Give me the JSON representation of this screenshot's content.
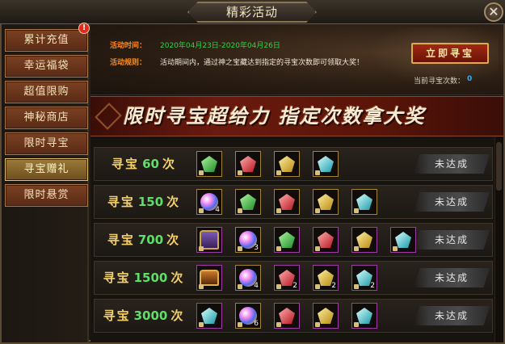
{
  "window": {
    "title": "精彩活动",
    "close_label": "✕"
  },
  "sidebar": {
    "badge": "!",
    "items": [
      {
        "label": "累计充值"
      },
      {
        "label": "幸运福袋"
      },
      {
        "label": "超值限购"
      },
      {
        "label": "神秘商店"
      },
      {
        "label": "限时寻宝"
      },
      {
        "label": "寻宝赠礼"
      },
      {
        "label": "限时悬赏"
      }
    ],
    "active_index": 5
  },
  "header": {
    "time_label": "活动时间：",
    "time_value": "2020年04月23日-2020年04月26日",
    "rule_label": "活动规则：",
    "rule_value": "活动期间内，通过神之宝藏达到指定的寻宝次数即可领取大奖！",
    "go_button": "立即寻宝",
    "count_label": "当前寻宝次数：",
    "count_value": "0"
  },
  "banner": {
    "text": "限时寻宝超给力 指定次数拿大奖"
  },
  "rows": [
    {
      "prefix": "寻宝",
      "count": "60",
      "suffix": "次",
      "status": "未达成",
      "items": [
        {
          "icon": "green-gem"
        },
        {
          "icon": "red-gem"
        },
        {
          "icon": "yellow-gem"
        },
        {
          "icon": "cyan-gem"
        }
      ]
    },
    {
      "prefix": "寻宝",
      "count": "150",
      "suffix": "次",
      "status": "未达成",
      "items": [
        {
          "icon": "rainbow-orb",
          "qty": "4"
        },
        {
          "icon": "green-gem"
        },
        {
          "icon": "red-gem"
        },
        {
          "icon": "yellow-gem"
        },
        {
          "icon": "cyan-gem"
        }
      ]
    },
    {
      "prefix": "寻宝",
      "count": "700",
      "suffix": "次",
      "status": "未达成",
      "items": [
        {
          "icon": "armor"
        },
        {
          "icon": "rainbow-orb",
          "qty": "3"
        },
        {
          "icon": "green-gem"
        },
        {
          "icon": "red-gem"
        },
        {
          "icon": "yellow-gem"
        },
        {
          "icon": "cyan-gem"
        }
      ]
    },
    {
      "prefix": "寻宝",
      "count": "1500",
      "suffix": "次",
      "status": "未达成",
      "items": [
        {
          "icon": "chest"
        },
        {
          "icon": "rainbow-orb",
          "qty": "4"
        },
        {
          "icon": "red-gem",
          "qty": "2"
        },
        {
          "icon": "yellow-gem",
          "qty": "2"
        },
        {
          "icon": "cyan-gem",
          "qty": "2"
        }
      ]
    },
    {
      "prefix": "寻宝",
      "count": "3000",
      "suffix": "次",
      "status": "未达成",
      "items": [
        {
          "icon": "cyan-gem"
        },
        {
          "icon": "rainbow-orb",
          "qty": "6"
        },
        {
          "icon": "red-gem"
        },
        {
          "icon": "yellow-gem"
        },
        {
          "icon": "cyan-gem"
        }
      ]
    }
  ]
}
